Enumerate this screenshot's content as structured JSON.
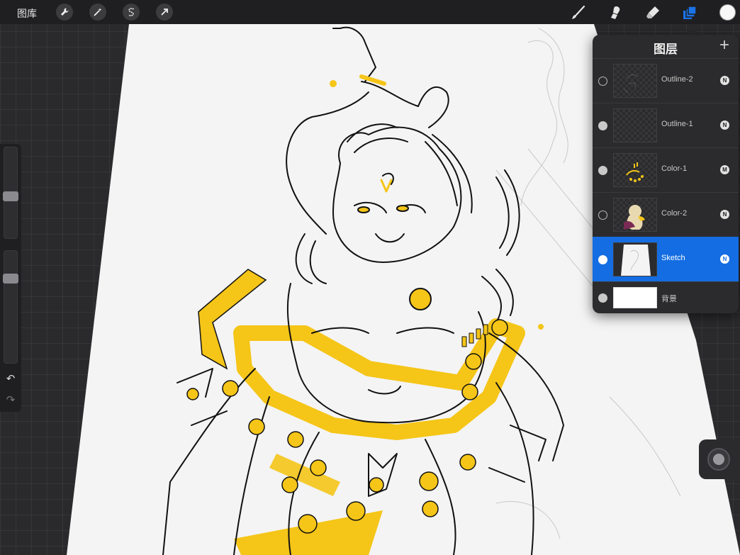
{
  "toolbar": {
    "gallery_label": "图库",
    "left_tools": [
      {
        "icon": "wrench-icon",
        "name": "actions"
      },
      {
        "icon": "magic-wand-icon",
        "name": "adjustments"
      },
      {
        "icon": "selection-s-icon",
        "name": "selection"
      },
      {
        "icon": "transform-arrow-icon",
        "name": "transform"
      }
    ],
    "right_tools": [
      {
        "icon": "brush-icon",
        "name": "paint"
      },
      {
        "icon": "smudge-icon",
        "name": "smudge"
      },
      {
        "icon": "eraser-icon",
        "name": "erase"
      },
      {
        "icon": "layers-icon",
        "name": "layers",
        "active": true
      }
    ],
    "current_color": "#f7f7f7",
    "active_color": "#1a73e8"
  },
  "layers_panel": {
    "title": "图层",
    "add_icon": "+",
    "layers": [
      {
        "name": "Outline-2",
        "blend": "N",
        "visible": false,
        "selected": false,
        "thumb": "sketch-lines"
      },
      {
        "name": "Outline-1",
        "blend": "N",
        "visible": true,
        "selected": false,
        "thumb": "empty"
      },
      {
        "name": "Color-1",
        "blend": "M",
        "visible": true,
        "selected": false,
        "thumb": "yellow"
      },
      {
        "name": "Color-2",
        "blend": "N",
        "visible": false,
        "selected": false,
        "thumb": "figure"
      },
      {
        "name": "Sketch",
        "blend": "N",
        "visible": true,
        "selected": true,
        "thumb": "white-page"
      }
    ],
    "background": {
      "name": "背景",
      "visible": true,
      "color": "#ffffff"
    }
  },
  "sidebar": {
    "size_slider": 0.4,
    "opacity_slider": 0.05,
    "undo_icon": "↶",
    "redo_icon": "↷"
  },
  "colors": {
    "accent_yellow": "#f5c518",
    "selection_blue": "#146de2",
    "paper": "#f4f4f4"
  }
}
